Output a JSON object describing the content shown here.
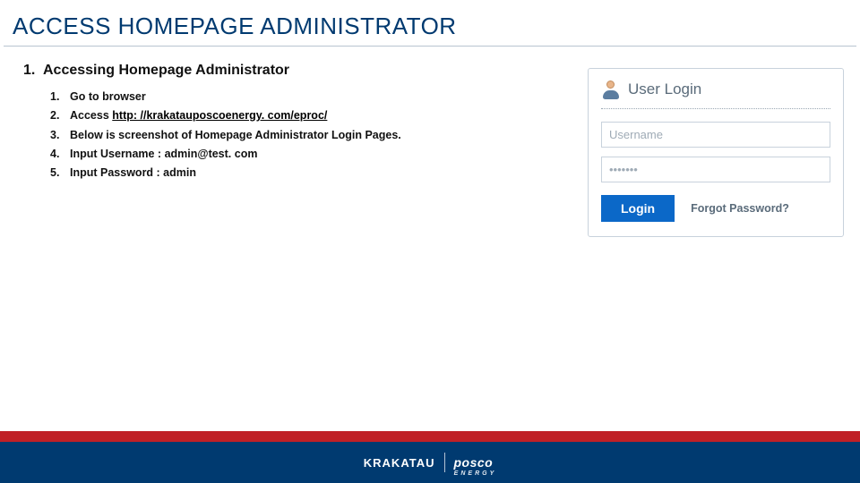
{
  "title": "ACCESS HOMEPAGE ADMINISTRATOR",
  "section": {
    "number": "1.",
    "heading": "Accessing Homepage Administrator",
    "steps": [
      {
        "n": "1.",
        "text": "Go to browser"
      },
      {
        "n": "2.",
        "prefix": "Access ",
        "url": "http: //krakatauposcoenergy. com/eproc/"
      },
      {
        "n": "3.",
        "text": "Below is screenshot of Homepage Administrator Login Pages."
      },
      {
        "n": "4.",
        "text": "Input Username : admin@test. com"
      },
      {
        "n": "5.",
        "text": "Input Password : admin"
      }
    ]
  },
  "login": {
    "heading": "User Login",
    "username_value": "Username",
    "password_value": "•••••••",
    "button": "Login",
    "forgot": "Forgot Password?"
  },
  "footer": {
    "brand1": "KRAKATAU",
    "brand2": "posco",
    "brand2_sub": "ENERGY"
  }
}
